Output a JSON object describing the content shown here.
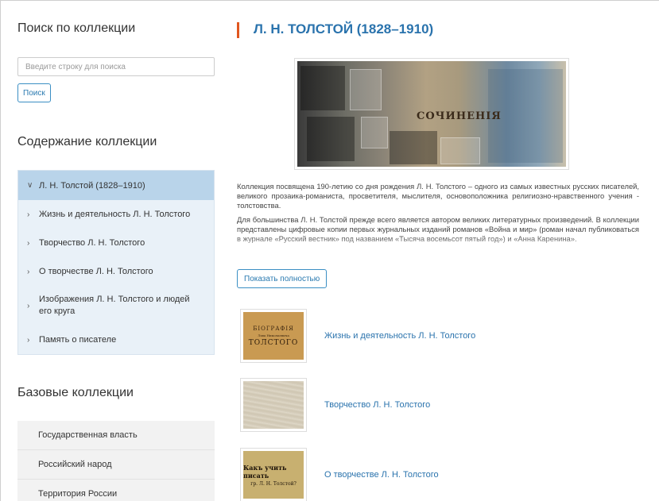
{
  "sidebar": {
    "search_heading": "Поиск по коллекции",
    "search_placeholder": "Введите строку для поиска",
    "search_button": "Поиск",
    "contents_heading": "Содержание коллекции",
    "tree": [
      {
        "label": "Л. Н. Толстой (1828–1910)",
        "icon": "chevron-down-icon",
        "glyph": "∨",
        "active": true
      },
      {
        "label": "Жизнь и деятельность Л. Н. Толстого",
        "icon": "chevron-right-icon",
        "glyph": "›"
      },
      {
        "label": "Творчество Л. Н. Толстого",
        "icon": "chevron-right-icon",
        "glyph": "›"
      },
      {
        "label": "О творчестве Л. Н. Толстого",
        "icon": "chevron-right-icon",
        "glyph": "›"
      },
      {
        "label": "Изображения Л. Н. Толстого и людей его круга",
        "icon": "chevron-right-icon",
        "glyph": "›"
      },
      {
        "label": "Память о писателе",
        "icon": "chevron-right-icon",
        "glyph": "›"
      }
    ],
    "base_heading": "Базовые коллекции",
    "base_items": [
      "Государственная власть",
      "Российский народ",
      "Территория России"
    ]
  },
  "main": {
    "title": "Л. Н. ТОЛСТОЙ (1828–1910)",
    "banner_caption": "СОЧИНЕНІЯ",
    "paragraphs": [
      "Коллекция посвящена 190-летию со дня рождения Л. Н. Толстого – одного из самых известных русских писателей, великого прозаика-романиста, просветителя, мыслителя, основоположника религиозно-нравственного учения - толстовства.",
      "Для большинства Л. Н. Толстой прежде всего является автором великих литературных произведений. В коллекции представлены цифровые копии первых журнальных изданий романов «Война и мир» (роман начал публиковаться в журнале «Русский вестник» под названием «Тысяча восемьсот пятый год») и «Анна Каренина»."
    ],
    "more_button": "Показать полностью",
    "subcollections": [
      {
        "label": "Жизнь и деятельность Л. Н. Толстого",
        "thumb_lines": [
          "БІОГРАФІЯ",
          "Льва Николаевича",
          "ТОЛСТОГО"
        ]
      },
      {
        "label": "Творчество Л. Н. Толстого",
        "thumb_lines": []
      },
      {
        "label": "О творчестве Л. Н. Толстого",
        "thumb_lines": [
          "Какъ учить писать",
          "гр. Л. Н. Толстой?"
        ]
      }
    ]
  }
}
